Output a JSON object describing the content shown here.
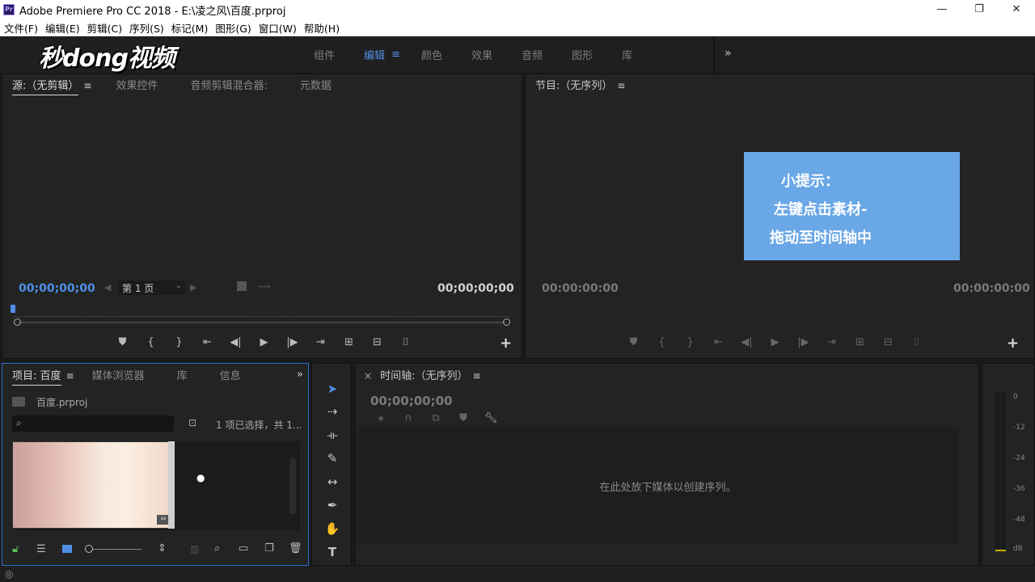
{
  "window": {
    "title": "Adobe Premiere Pro CC 2018 - E:\\凌之风\\百度.prproj",
    "app_icon": "Pr",
    "minimize": "—",
    "restore": "❐",
    "close": "✕"
  },
  "menu": [
    "文件(F)",
    "编辑(E)",
    "剪辑(C)",
    "序列(S)",
    "标记(M)",
    "图形(G)",
    "窗口(W)",
    "帮助(H)"
  ],
  "workspace": {
    "logo": "秒dong视频",
    "tabs": [
      "组件",
      "编辑",
      "颜色",
      "效果",
      "音频",
      "图形",
      "库"
    ],
    "active_tab": "编辑",
    "tab_menu": "≡",
    "more": "»"
  },
  "source": {
    "tabs": [
      "源:（无剪辑）",
      "效果控件",
      "音频剪辑混合器:",
      "元数据"
    ],
    "menu": "≡",
    "timecode_left": "00;00;00;00",
    "timecode_right": "00;00;00;00",
    "page_select": "第 1 页"
  },
  "program": {
    "tab": "节目:（无序列）",
    "menu": "≡",
    "timecode_left": "00:00:00:00",
    "timecode_right": "00:00:00:00"
  },
  "hint": {
    "line1": "小提示：",
    "line2": "左键点击素材-",
    "line3": "拖动至时间轴中"
  },
  "project": {
    "tabs": [
      "项目: 百度",
      "媒体浏览器",
      "库",
      "信息"
    ],
    "menu": "≡",
    "more": "»",
    "file": "百度.prproj",
    "search_placeholder": "",
    "selection_status": "1 项已选择，共 1..."
  },
  "timeline": {
    "close": "×",
    "tab": "时间轴:（无序列）",
    "menu": "≡",
    "timecode": "00;00;00;00",
    "drop_hint": "在此处放下媒体以创建序列。"
  },
  "meter": {
    "labels": [
      "0",
      "-12",
      "-24",
      "-36",
      "-48",
      "dB"
    ]
  },
  "colors": {
    "accent": "#4f8fe6",
    "hint_bg": "#69a7e6",
    "panel_bg": "#232323"
  }
}
